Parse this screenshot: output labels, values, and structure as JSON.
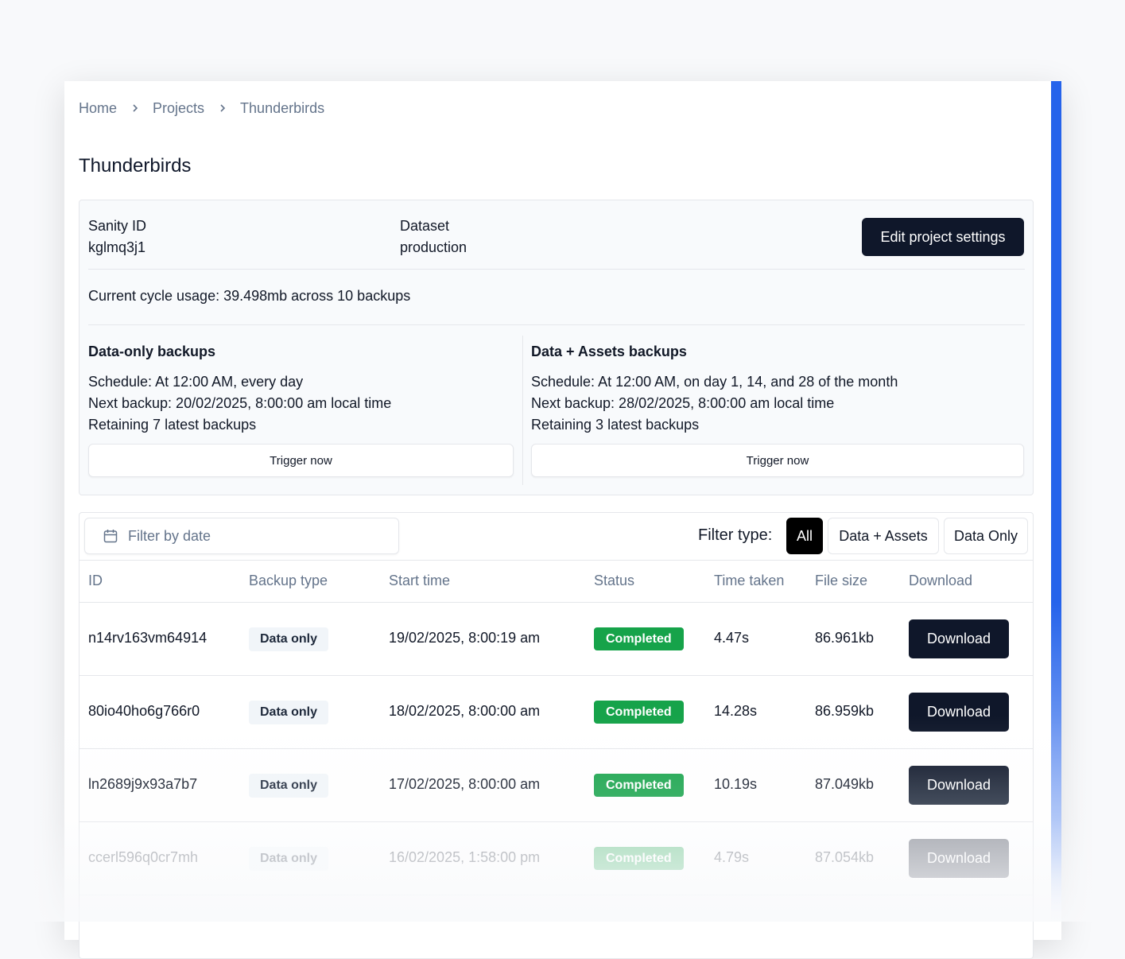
{
  "breadcrumb": [
    "Home",
    "Projects",
    "Thunderbirds"
  ],
  "page_title": "Thunderbirds",
  "project": {
    "sanity_id_label": "Sanity ID",
    "sanity_id": "kglmq3j1",
    "dataset_label": "Dataset",
    "dataset": "production",
    "edit_button": "Edit project settings",
    "usage": "Current cycle usage: 39.498mb across 10 backups"
  },
  "schedules": {
    "data_only": {
      "title": "Data-only backups",
      "schedule": "Schedule: At 12:00 AM, every day",
      "next": "Next backup: 20/02/2025, 8:00:00 am local time",
      "retaining": "Retaining 7 latest backups",
      "trigger": "Trigger now"
    },
    "data_assets": {
      "title": "Data + Assets backups",
      "schedule": "Schedule: At 12:00 AM, on day 1, 14, and 28 of the month",
      "next": "Next backup: 28/02/2025, 8:00:00 am local time",
      "retaining": "Retaining 3 latest backups",
      "trigger": "Trigger now"
    }
  },
  "filters": {
    "date_placeholder": "Filter by date",
    "type_label": "Filter type:",
    "types": [
      "All",
      "Data + Assets",
      "Data Only"
    ],
    "active_type": "All"
  },
  "table": {
    "headers": [
      "ID",
      "Backup type",
      "Start time",
      "Status",
      "Time taken",
      "File size",
      "Download"
    ],
    "rows": [
      {
        "id": "n14rv163vm64914",
        "type": "Data only",
        "start": "19/02/2025, 8:00:19 am",
        "status": "Completed",
        "time": "4.47s",
        "size": "86.961kb",
        "download": "Download"
      },
      {
        "id": "80io40ho6g766r0",
        "type": "Data only",
        "start": "18/02/2025, 8:00:00 am",
        "status": "Completed",
        "time": "14.28s",
        "size": "86.959kb",
        "download": "Download"
      },
      {
        "id": "ln2689j9x93a7b7",
        "type": "Data only",
        "start": "17/02/2025, 8:00:00 am",
        "status": "Completed",
        "time": "10.19s",
        "size": "87.049kb",
        "download": "Download"
      },
      {
        "id": "ccerl596q0cr7mh",
        "type": "Data only",
        "start": "16/02/2025, 1:58:00 pm",
        "status": "Completed",
        "time": "4.79s",
        "size": "87.054kb",
        "download": "Download"
      }
    ]
  },
  "colors": {
    "accent": "#2563eb",
    "primary_button": "#0f172a",
    "status_completed": "#16a34a"
  }
}
